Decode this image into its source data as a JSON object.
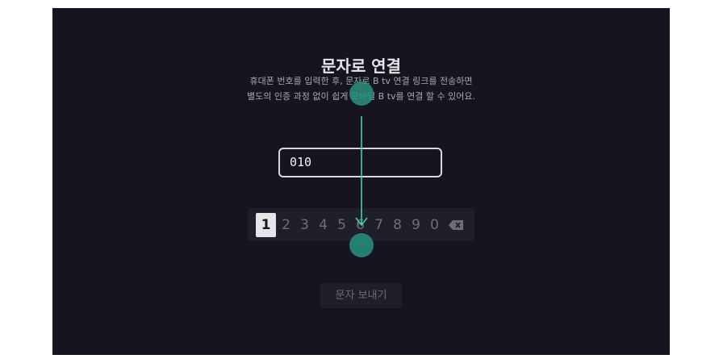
{
  "title": "문자로 연결",
  "description_line1": "휴대폰 번호를 입력한 후, 문자로 B tv 연결 링크를 전송하면",
  "description_line2": "별도의 인증 과정 없이 쉽게 모바일 B tv를 연결 할 수 있어요.",
  "phone_input_value": "010",
  "keypad": {
    "keys": [
      "1",
      "2",
      "3",
      "4",
      "5",
      "6",
      "7",
      "8",
      "9",
      "0"
    ],
    "selected_key": "1",
    "delete_icon": "backspace-icon"
  },
  "send_button_label": "문자 보내기",
  "colors": {
    "screen_bg": "#16151f",
    "drag_marker": "#2a8f7c",
    "drag_arrow": "#3bd2b0"
  }
}
